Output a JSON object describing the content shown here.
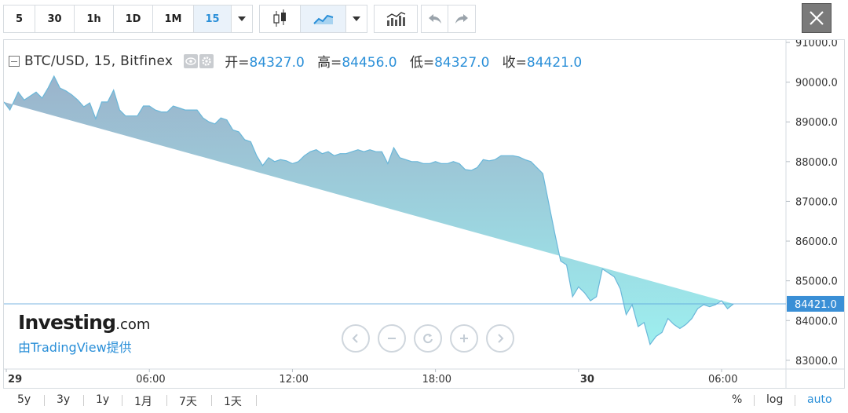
{
  "toolbar": {
    "intervals": [
      "5",
      "30",
      "1h",
      "1D",
      "1M",
      "15"
    ],
    "active_interval": "15",
    "dropdown_icon": "caret-down-icon",
    "chart_type_icons": [
      "candles-icon",
      "area-chart-icon"
    ],
    "indicators_icon": "indicators-icon",
    "undo_icon": "undo-icon",
    "redo_icon": "redo-icon",
    "close_icon": "close-icon"
  },
  "legend": {
    "symbol": "BTC/USD, 15, Bitfinex",
    "open_label": "开=",
    "open": "84327.0",
    "high_label": "高=",
    "high": "84456.0",
    "low_label": "低=",
    "low": "84327.0",
    "close_label": "收=",
    "close": "84421.0"
  },
  "watermark": {
    "logo_main": "Investing",
    "logo_suffix": ".com",
    "subtitle": "由TradingView提供"
  },
  "nav_icons": [
    "chevron-left-icon",
    "minus-icon",
    "reset-icon",
    "plus-icon",
    "chevron-right-icon"
  ],
  "bottombar": {
    "ranges": [
      "5y",
      "3y",
      "1y",
      "1月",
      "7天",
      "1天"
    ],
    "percent": "%",
    "log": "log",
    "auto": "auto"
  },
  "colors": {
    "accent": "#2a8fd8",
    "line": "#6ab7d9",
    "fill_top": "#9bb3cb",
    "fill_bottom": "#9defef",
    "last_price_bg": "#3a8fd6"
  },
  "chart_data": {
    "type": "area",
    "title": "",
    "xlabel": "",
    "ylabel": "",
    "ylim": [
      82780,
      91060
    ],
    "y_ticks": [
      83000,
      84000,
      85000,
      86000,
      87000,
      88000,
      89000,
      90000,
      91000
    ],
    "y_tick_labels": [
      "83000.0",
      "84000.0",
      "85000.0",
      "86000.0",
      "87000.0",
      "88000.0",
      "89000.0",
      "90000.0",
      "91000.0"
    ],
    "x_ticks": [
      {
        "label": "29",
        "hour": 0,
        "bold": true
      },
      {
        "label": "06:00",
        "hour": 6,
        "bold": false
      },
      {
        "label": "12:00",
        "hour": 12,
        "bold": false
      },
      {
        "label": "18:00",
        "hour": 18,
        "bold": false
      },
      {
        "label": "30",
        "hour": 24,
        "bold": true
      },
      {
        "label": "06:00",
        "hour": 30,
        "bold": false
      }
    ],
    "x_range_hours": [
      -0.1,
      32.7
    ],
    "last_price": 84421.0,
    "last_price_label": "84421.0",
    "series": [
      {
        "x_hours": [
          -0.1,
          0.15,
          0.5,
          0.75,
          1.0,
          1.25,
          1.5,
          1.75,
          2.0,
          2.25,
          2.5,
          2.75,
          3.0,
          3.25,
          3.5,
          3.75,
          4.0,
          4.25,
          4.5,
          4.75,
          5.0,
          5.25,
          5.5,
          5.75,
          6.0,
          6.25,
          6.5,
          6.75,
          7.0,
          7.25,
          7.5,
          7.75,
          8.0,
          8.25,
          8.5,
          8.75,
          9.0,
          9.25,
          9.5,
          9.75,
          10.0,
          10.25,
          10.5,
          10.75,
          11.0,
          11.25,
          11.5,
          11.75,
          12.0,
          12.25,
          12.5,
          12.75,
          13.0,
          13.25,
          13.5,
          13.75,
          14.0,
          14.25,
          14.5,
          14.75,
          15.0,
          15.25,
          15.5,
          15.75,
          16.0,
          16.25,
          16.5,
          16.75,
          17.0,
          17.25,
          17.5,
          17.75,
          18.0,
          18.25,
          18.5,
          18.75,
          19.0,
          19.25,
          19.5,
          19.75,
          20.0,
          20.25,
          20.5,
          20.75,
          21.0,
          21.25,
          21.5,
          21.75,
          22.0,
          22.25,
          22.5,
          22.75,
          23.0,
          23.25,
          23.5,
          23.75,
          24.0,
          24.25,
          24.5,
          24.75,
          25.0,
          25.25,
          25.5,
          25.75,
          26.0,
          26.25,
          26.5,
          26.75,
          27.0,
          27.25,
          27.5,
          27.75,
          28.0,
          28.25,
          28.5,
          28.75,
          29.0,
          29.25,
          29.5,
          29.75,
          30.0,
          30.25,
          30.5,
          30.75,
          31.0,
          31.25,
          31.5,
          31.75,
          32.0,
          32.25
        ],
        "values": [
          89500,
          89300,
          89750,
          89550,
          89650,
          89750,
          89600,
          89850,
          90150,
          89850,
          89780,
          89680,
          89550,
          89380,
          89480,
          89080,
          89500,
          89500,
          89800,
          89300,
          89150,
          89150,
          89150,
          89400,
          89400,
          89300,
          89250,
          89250,
          89400,
          89350,
          89300,
          89300,
          89300,
          89100,
          89000,
          88950,
          89100,
          89050,
          88800,
          88750,
          88550,
          88500,
          88150,
          87900,
          88100,
          88000,
          88050,
          88020,
          87950,
          88000,
          88150,
          88250,
          88300,
          88200,
          88250,
          88150,
          88200,
          88200,
          88250,
          88300,
          88250,
          88300,
          88250,
          88250,
          87950,
          88350,
          88100,
          88050,
          88000,
          88000,
          87950,
          87950,
          88000,
          87950,
          87950,
          88000,
          87950,
          87800,
          87780,
          87850,
          88050,
          88020,
          88050,
          88150,
          88150,
          88150,
          88120,
          88050,
          88000,
          87850,
          87700,
          86950,
          86200,
          85500,
          85400,
          84600,
          84850,
          84700,
          84500,
          84600,
          85300,
          85200,
          85100,
          84800,
          84150,
          84400,
          83850,
          83950,
          83400,
          83600,
          83700,
          84050,
          83900,
          83800,
          83900,
          84050,
          84300,
          84400,
          84350,
          84400,
          84500,
          84300,
          84421
        ]
      }
    ]
  }
}
